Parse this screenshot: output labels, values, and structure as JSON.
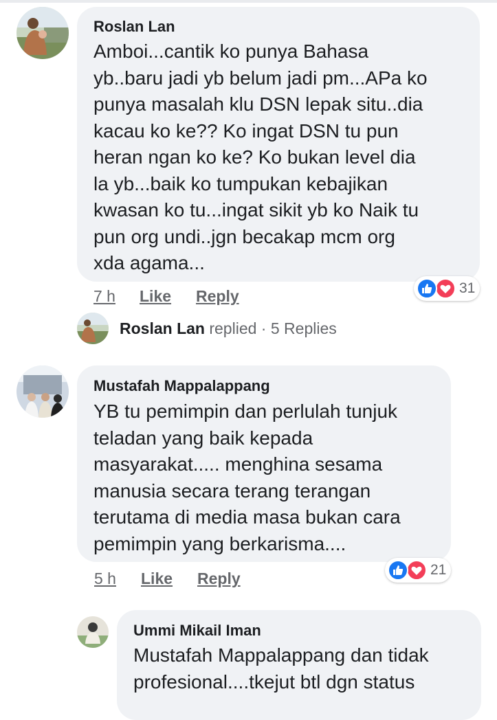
{
  "comments": [
    {
      "author": "Roslan Lan",
      "text": "Amboi...cantik ko  punya Bahasa\nyb..baru jadi yb belum jadi pm...APa ko\npunya masalah klu DSN lepak situ..dia\nkacau ko ke?? Ko ingat DSN tu pun\nheran ngan ko ke? Ko bukan level dia\nla yb...baik ko tumpukan kebajikan\nkwasan ko tu...ingat sikit yb ko Naik tu\npun org undi..jgn becakap mcm org\nxda agama...",
      "time": "7 h",
      "like_label": "Like",
      "reply_label": "Reply",
      "reaction_count": "31",
      "replies_summary": {
        "name": "Roslan Lan",
        "verb": "replied",
        "separator": "·",
        "count_label": "5 Replies"
      }
    },
    {
      "author": "Mustafah Mappalappang",
      "text": "YB tu pemimpin dan perlulah tunjuk\nteladan yang baik kepada\nmasyarakat..... menghina sesama\nmanusia secara terang terangan\nterutama di media masa bukan cara\npemimpin yang berkarisma....",
      "time": "5 h",
      "like_label": "Like",
      "reply_label": "Reply",
      "reaction_count": "21"
    },
    {
      "author": "Ummi Mikail Iman",
      "text": "Mustafah Mappalappang dan tidak\nprofesional....tkejut btl dgn status"
    }
  ],
  "colors": {
    "bubble": "#f0f2f5",
    "meta_text": "#65676b",
    "like_blue": "#1877f2",
    "love_red": "#f33e58"
  },
  "icons": {
    "like": "thumbs-up-icon",
    "love": "heart-icon"
  }
}
